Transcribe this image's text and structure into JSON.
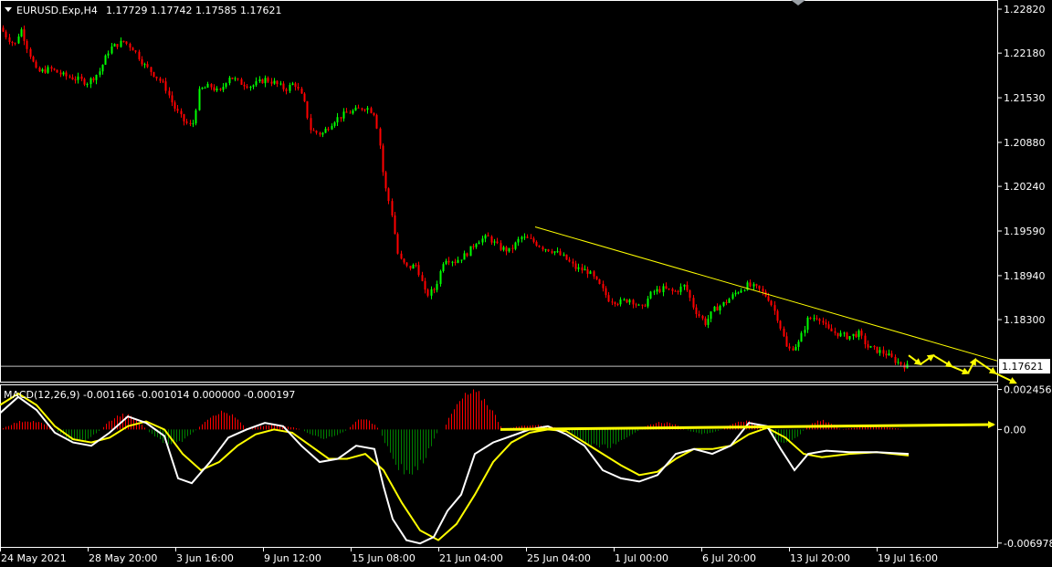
{
  "header": {
    "symbol": "EURUSD.Exp,H4",
    "ohlc": "1.17729 1.17742 1.17585 1.17621"
  },
  "macd_header": "MACD(12,26,9) -0.001166 -0.001014 0.000000 -0.000197",
  "colors": {
    "background": "#000000",
    "bull": "#00ff00",
    "bear": "#ff0000",
    "axis": "#ffffff",
    "macd_line": "#ffffff",
    "signal_line": "#ffff00",
    "annotation": "#ffff00",
    "hist_pos": "#ff0000",
    "hist_neg": "#008000"
  },
  "chart_data": [
    {
      "type": "candlestick",
      "price_axis": [
        "1.22820",
        "1.22180",
        "1.21530",
        "1.20880",
        "1.20240",
        "1.19590",
        "1.18940",
        "1.18300"
      ],
      "current_price": "1.17621",
      "ylim": [
        1.1745,
        1.229
      ],
      "x_tick_labels": [
        "24 May 2021",
        "28 May 20:00",
        "3 Jun 16:00",
        "9 Jun 12:00",
        "15 Jun 08:00",
        "21 Jun 04:00",
        "25 Jun 04:00",
        "1 Jul 00:00",
        "6 Jul 20:00",
        "13 Jul 20:00",
        "19 Jul 16:00"
      ],
      "close_path": [
        [
          0,
          1.2255
        ],
        [
          8,
          1.224
        ],
        [
          16,
          1.223
        ],
        [
          22,
          1.2255
        ],
        [
          30,
          1.2225
        ],
        [
          40,
          1.219
        ],
        [
          55,
          1.2195
        ],
        [
          70,
          1.2185
        ],
        [
          85,
          1.218
        ],
        [
          95,
          1.2175
        ],
        [
          108,
          1.219
        ],
        [
          120,
          1.2225
        ],
        [
          135,
          1.2235
        ],
        [
          145,
          1.2225
        ],
        [
          158,
          1.22
        ],
        [
          170,
          1.2185
        ],
        [
          180,
          1.217
        ],
        [
          190,
          1.214
        ],
        [
          200,
          1.212
        ],
        [
          210,
          1.211
        ],
        [
          218,
          1.2165
        ],
        [
          230,
          1.217
        ],
        [
          240,
          1.216
        ],
        [
          250,
          1.2185
        ],
        [
          262,
          1.2175
        ],
        [
          275,
          1.217
        ],
        [
          290,
          1.218
        ],
        [
          300,
          1.2175
        ],
        [
          312,
          1.2165
        ],
        [
          322,
          1.2175
        ],
        [
          332,
          1.215
        ],
        [
          340,
          1.2105
        ],
        [
          352,
          1.21
        ],
        [
          365,
          1.212
        ],
        [
          378,
          1.213
        ],
        [
          390,
          1.2135
        ],
        [
          400,
          1.214
        ],
        [
          410,
          1.213
        ],
        [
          416,
          1.208
        ],
        [
          420,
          1.203
        ],
        [
          428,
          1.199
        ],
        [
          436,
          1.192
        ],
        [
          446,
          1.1905
        ],
        [
          456,
          1.191
        ],
        [
          466,
          1.1865
        ],
        [
          476,
          1.1875
        ],
        [
          486,
          1.192
        ],
        [
          498,
          1.1915
        ],
        [
          510,
          1.1925
        ],
        [
          522,
          1.1945
        ],
        [
          534,
          1.195
        ],
        [
          546,
          1.1935
        ],
        [
          558,
          1.193
        ],
        [
          570,
          1.195
        ],
        [
          582,
          1.1945
        ],
        [
          594,
          1.1935
        ],
        [
          606,
          1.193
        ],
        [
          618,
          1.192
        ],
        [
          630,
          1.1905
        ],
        [
          644,
          1.19
        ],
        [
          656,
          1.188
        ],
        [
          666,
          1.186
        ],
        [
          678,
          1.1855
        ],
        [
          690,
          1.186
        ],
        [
          702,
          1.1845
        ],
        [
          714,
          1.187
        ],
        [
          726,
          1.1875
        ],
        [
          738,
          1.187
        ],
        [
          750,
          1.188
        ],
        [
          760,
          1.1845
        ],
        [
          772,
          1.1825
        ],
        [
          782,
          1.1845
        ],
        [
          794,
          1.1855
        ],
        [
          806,
          1.187
        ],
        [
          818,
          1.188
        ],
        [
          830,
          1.1875
        ],
        [
          842,
          1.186
        ],
        [
          852,
          1.183
        ],
        [
          862,
          1.1785
        ],
        [
          874,
          1.1795
        ],
        [
          884,
          1.183
        ],
        [
          896,
          1.1835
        ],
        [
          906,
          1.1815
        ],
        [
          916,
          1.181
        ],
        [
          928,
          1.1805
        ],
        [
          940,
          1.181
        ],
        [
          950,
          1.179
        ],
        [
          960,
          1.1785
        ],
        [
          970,
          1.178
        ],
        [
          980,
          1.177
        ],
        [
          992,
          1.1762
        ]
      ]
    },
    {
      "type": "macd",
      "axis_labels": [
        "0.002456",
        "0.00",
        "-0.006978"
      ],
      "ylim": [
        -0.0071,
        0.0026
      ],
      "macd": [
        [
          0,
          0.001
        ],
        [
          20,
          0.002
        ],
        [
          40,
          0.0012
        ],
        [
          60,
          -0.0002
        ],
        [
          80,
          -0.0008
        ],
        [
          100,
          -0.001
        ],
        [
          120,
          -0.0002
        ],
        [
          140,
          0.0008
        ],
        [
          160,
          0.0004
        ],
        [
          180,
          -0.0004
        ],
        [
          195,
          -0.003
        ],
        [
          210,
          -0.0033
        ],
        [
          230,
          -0.002
        ],
        [
          250,
          -0.0005
        ],
        [
          270,
          0.0
        ],
        [
          290,
          0.0004
        ],
        [
          310,
          0.0002
        ],
        [
          330,
          -0.001
        ],
        [
          350,
          -0.002
        ],
        [
          370,
          -0.0018
        ],
        [
          390,
          -0.001
        ],
        [
          410,
          -0.0012
        ],
        [
          420,
          -0.0035
        ],
        [
          430,
          -0.0055
        ],
        [
          445,
          -0.0068
        ],
        [
          460,
          -0.007
        ],
        [
          475,
          -0.0066
        ],
        [
          490,
          -0.005
        ],
        [
          505,
          -0.004
        ],
        [
          520,
          -0.0015
        ],
        [
          540,
          -0.0008
        ],
        [
          560,
          -0.0004
        ],
        [
          580,
          0.0
        ],
        [
          600,
          0.0002
        ],
        [
          620,
          -0.0003
        ],
        [
          640,
          -0.001
        ],
        [
          660,
          -0.0025
        ],
        [
          680,
          -0.003
        ],
        [
          700,
          -0.0032
        ],
        [
          720,
          -0.0028
        ],
        [
          740,
          -0.0015
        ],
        [
          760,
          -0.0012
        ],
        [
          780,
          -0.0015
        ],
        [
          800,
          -0.001
        ],
        [
          820,
          0.0004
        ],
        [
          840,
          0.0002
        ],
        [
          855,
          -0.0012
        ],
        [
          870,
          -0.0025
        ],
        [
          885,
          -0.0015
        ],
        [
          905,
          -0.0013
        ],
        [
          930,
          -0.0014
        ],
        [
          960,
          -0.0014
        ],
        [
          995,
          -0.0015
        ]
      ],
      "signal": [
        [
          0,
          0.0015
        ],
        [
          20,
          0.0022
        ],
        [
          40,
          0.0015
        ],
        [
          60,
          0.0002
        ],
        [
          80,
          -0.0006
        ],
        [
          100,
          -0.0008
        ],
        [
          120,
          -0.0005
        ],
        [
          140,
          0.0002
        ],
        [
          160,
          0.0005
        ],
        [
          180,
          0.0
        ],
        [
          200,
          -0.0015
        ],
        [
          220,
          -0.0025
        ],
        [
          240,
          -0.002
        ],
        [
          260,
          -0.001
        ],
        [
          280,
          -0.0003
        ],
        [
          300,
          0.0
        ],
        [
          320,
          -0.0002
        ],
        [
          340,
          -0.001
        ],
        [
          360,
          -0.0018
        ],
        [
          380,
          -0.0018
        ],
        [
          400,
          -0.0015
        ],
        [
          420,
          -0.0025
        ],
        [
          440,
          -0.0045
        ],
        [
          460,
          -0.0062
        ],
        [
          480,
          -0.0068
        ],
        [
          500,
          -0.0058
        ],
        [
          520,
          -0.004
        ],
        [
          540,
          -0.002
        ],
        [
          560,
          -0.0008
        ],
        [
          580,
          -0.0002
        ],
        [
          600,
          0.0
        ],
        [
          620,
          -0.0001
        ],
        [
          640,
          -0.0008
        ],
        [
          660,
          -0.0015
        ],
        [
          680,
          -0.0022
        ],
        [
          700,
          -0.0028
        ],
        [
          720,
          -0.0026
        ],
        [
          740,
          -0.0018
        ],
        [
          760,
          -0.0012
        ],
        [
          780,
          -0.0012
        ],
        [
          800,
          -0.001
        ],
        [
          820,
          -0.0003
        ],
        [
          840,
          0.0001
        ],
        [
          860,
          -0.0005
        ],
        [
          880,
          -0.0015
        ],
        [
          900,
          -0.0017
        ],
        [
          930,
          -0.0015
        ],
        [
          960,
          -0.0014
        ],
        [
          995,
          -0.0016
        ]
      ],
      "histogram_bands": [
        [
          0,
          60,
          0.0006
        ],
        [
          60,
          110,
          -0.0008
        ],
        [
          110,
          160,
          0.001
        ],
        [
          160,
          215,
          -0.001
        ],
        [
          215,
          270,
          0.0012
        ],
        [
          270,
          330,
          0.0003
        ],
        [
          330,
          380,
          -0.0006
        ],
        [
          380,
          415,
          0.0007
        ],
        [
          415,
          480,
          -0.003
        ],
        [
          485,
          550,
          0.0025
        ],
        [
          550,
          620,
          0.0003
        ],
        [
          620,
          700,
          -0.0012
        ],
        [
          700,
          750,
          0.0005
        ],
        [
          750,
          790,
          -0.0003
        ],
        [
          790,
          840,
          0.0006
        ],
        [
          840,
          880,
          -0.001
        ],
        [
          880,
          920,
          0.0006
        ],
        [
          920,
          990,
          0.0002
        ]
      ]
    }
  ],
  "annotations": {
    "trendline_start": [
      586,
      1.1965
    ],
    "trendline_end": [
      1092,
      1.177
    ],
    "macd_trend_start": [
      548,
      0.0
    ],
    "macd_trend_end": [
      1088,
      0.0003
    ],
    "forecast_zigzag": [
      [
        995,
        1.1778
      ],
      [
        1008,
        1.1765
      ],
      [
        1022,
        1.1778
      ],
      [
        1042,
        1.1762
      ],
      [
        1060,
        1.1752
      ],
      [
        1068,
        1.1772
      ],
      [
        1090,
        1.1752
      ],
      [
        1112,
        1.1738
      ]
    ]
  }
}
